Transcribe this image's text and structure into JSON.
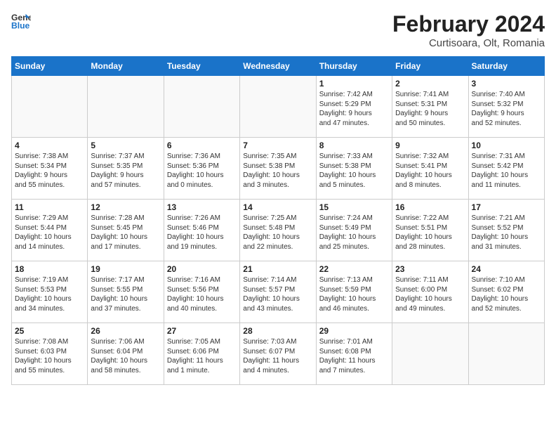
{
  "header": {
    "logo_line1": "General",
    "logo_line2": "Blue",
    "month_title": "February 2024",
    "subtitle": "Curtisoara, Olt, Romania"
  },
  "weekdays": [
    "Sunday",
    "Monday",
    "Tuesday",
    "Wednesday",
    "Thursday",
    "Friday",
    "Saturday"
  ],
  "weeks": [
    [
      {
        "day": "",
        "content": ""
      },
      {
        "day": "",
        "content": ""
      },
      {
        "day": "",
        "content": ""
      },
      {
        "day": "",
        "content": ""
      },
      {
        "day": "1",
        "content": "Sunrise: 7:42 AM\nSunset: 5:29 PM\nDaylight: 9 hours\nand 47 minutes."
      },
      {
        "day": "2",
        "content": "Sunrise: 7:41 AM\nSunset: 5:31 PM\nDaylight: 9 hours\nand 50 minutes."
      },
      {
        "day": "3",
        "content": "Sunrise: 7:40 AM\nSunset: 5:32 PM\nDaylight: 9 hours\nand 52 minutes."
      }
    ],
    [
      {
        "day": "4",
        "content": "Sunrise: 7:38 AM\nSunset: 5:34 PM\nDaylight: 9 hours\nand 55 minutes."
      },
      {
        "day": "5",
        "content": "Sunrise: 7:37 AM\nSunset: 5:35 PM\nDaylight: 9 hours\nand 57 minutes."
      },
      {
        "day": "6",
        "content": "Sunrise: 7:36 AM\nSunset: 5:36 PM\nDaylight: 10 hours\nand 0 minutes."
      },
      {
        "day": "7",
        "content": "Sunrise: 7:35 AM\nSunset: 5:38 PM\nDaylight: 10 hours\nand 3 minutes."
      },
      {
        "day": "8",
        "content": "Sunrise: 7:33 AM\nSunset: 5:38 PM\nDaylight: 10 hours\nand 5 minutes."
      },
      {
        "day": "9",
        "content": "Sunrise: 7:32 AM\nSunset: 5:41 PM\nDaylight: 10 hours\nand 8 minutes."
      },
      {
        "day": "10",
        "content": "Sunrise: 7:31 AM\nSunset: 5:42 PM\nDaylight: 10 hours\nand 11 minutes."
      }
    ],
    [
      {
        "day": "11",
        "content": "Sunrise: 7:29 AM\nSunset: 5:44 PM\nDaylight: 10 hours\nand 14 minutes."
      },
      {
        "day": "12",
        "content": "Sunrise: 7:28 AM\nSunset: 5:45 PM\nDaylight: 10 hours\nand 17 minutes."
      },
      {
        "day": "13",
        "content": "Sunrise: 7:26 AM\nSunset: 5:46 PM\nDaylight: 10 hours\nand 19 minutes."
      },
      {
        "day": "14",
        "content": "Sunrise: 7:25 AM\nSunset: 5:48 PM\nDaylight: 10 hours\nand 22 minutes."
      },
      {
        "day": "15",
        "content": "Sunrise: 7:24 AM\nSunset: 5:49 PM\nDaylight: 10 hours\nand 25 minutes."
      },
      {
        "day": "16",
        "content": "Sunrise: 7:22 AM\nSunset: 5:51 PM\nDaylight: 10 hours\nand 28 minutes."
      },
      {
        "day": "17",
        "content": "Sunrise: 7:21 AM\nSunset: 5:52 PM\nDaylight: 10 hours\nand 31 minutes."
      }
    ],
    [
      {
        "day": "18",
        "content": "Sunrise: 7:19 AM\nSunset: 5:53 PM\nDaylight: 10 hours\nand 34 minutes."
      },
      {
        "day": "19",
        "content": "Sunrise: 7:17 AM\nSunset: 5:55 PM\nDaylight: 10 hours\nand 37 minutes."
      },
      {
        "day": "20",
        "content": "Sunrise: 7:16 AM\nSunset: 5:56 PM\nDaylight: 10 hours\nand 40 minutes."
      },
      {
        "day": "21",
        "content": "Sunrise: 7:14 AM\nSunset: 5:57 PM\nDaylight: 10 hours\nand 43 minutes."
      },
      {
        "day": "22",
        "content": "Sunrise: 7:13 AM\nSunset: 5:59 PM\nDaylight: 10 hours\nand 46 minutes."
      },
      {
        "day": "23",
        "content": "Sunrise: 7:11 AM\nSunset: 6:00 PM\nDaylight: 10 hours\nand 49 minutes."
      },
      {
        "day": "24",
        "content": "Sunrise: 7:10 AM\nSunset: 6:02 PM\nDaylight: 10 hours\nand 52 minutes."
      }
    ],
    [
      {
        "day": "25",
        "content": "Sunrise: 7:08 AM\nSunset: 6:03 PM\nDaylight: 10 hours\nand 55 minutes."
      },
      {
        "day": "26",
        "content": "Sunrise: 7:06 AM\nSunset: 6:04 PM\nDaylight: 10 hours\nand 58 minutes."
      },
      {
        "day": "27",
        "content": "Sunrise: 7:05 AM\nSunset: 6:06 PM\nDaylight: 11 hours\nand 1 minute."
      },
      {
        "day": "28",
        "content": "Sunrise: 7:03 AM\nSunset: 6:07 PM\nDaylight: 11 hours\nand 4 minutes."
      },
      {
        "day": "29",
        "content": "Sunrise: 7:01 AM\nSunset: 6:08 PM\nDaylight: 11 hours\nand 7 minutes."
      },
      {
        "day": "",
        "content": ""
      },
      {
        "day": "",
        "content": ""
      }
    ]
  ]
}
